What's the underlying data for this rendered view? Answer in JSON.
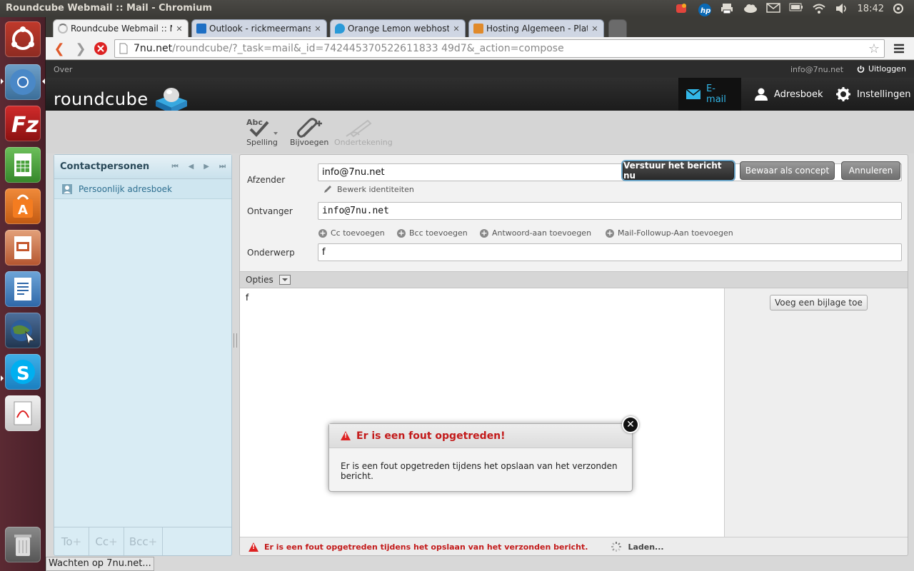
{
  "system": {
    "window_title": "Roundcube Webmail :: Mail - Chromium",
    "clock": "18:42"
  },
  "browser": {
    "tabs": [
      {
        "label": "Roundcube Webmail :: Ma",
        "favicon_color": "#888888",
        "active": true
      },
      {
        "label": "Outlook - rickmeermans@",
        "favicon_color": "#1e6fc4",
        "active": false
      },
      {
        "label": "Orange Lemon webhostin",
        "favicon_color": "#2a9ad8",
        "active": false
      },
      {
        "label": "Hosting Algemeen - Plat",
        "favicon_color": "#e08a2a",
        "active": false
      }
    ],
    "url_host": "7nu.net",
    "url_rest": "/roundcube/?_task=mail&_id=742445370522611833 49d7&_action=compose",
    "status_text": "Wachten op 7nu.net..."
  },
  "rc": {
    "about_link": "Over",
    "user_email": "info@7nu.net",
    "logout": "Uitloggen",
    "logo_text": "roundcube",
    "nav": {
      "email": "E-mail",
      "addressbook": "Adresboek",
      "settings": "Instellingen"
    },
    "toolbar": {
      "spell": "Spelling",
      "attach": "Bijvoegen",
      "signature": "Ondertekening",
      "spell_glyph": "Abc"
    },
    "left": {
      "title": "Contactpersonen",
      "addressbook": "Persoonlijk adresboek",
      "recipients": [
        "To",
        "Cc",
        "Bcc"
      ]
    },
    "compose": {
      "from_label": "Afzender",
      "from_value": "info@7nu.net",
      "edit_identities": "Bewerk identiteiten",
      "to_label": "Ontvanger",
      "to_value": "info@7nu.net",
      "add_cc": "Cc toevoegen",
      "add_bcc": "Bcc toevoegen",
      "add_replyto": "Antwoord-aan toevoegen",
      "add_followupto": "Mail-Followup-Aan toevoegen",
      "subject_label": "Onderwerp",
      "subject_value": "f",
      "send_button": "Verstuur het bericht nu",
      "save_button": "Bewaar als concept",
      "cancel_button": "Annuleren",
      "options_label": "Opties",
      "body": "f",
      "add_attachment": "Voeg een bijlage toe"
    },
    "error": {
      "title": "Er is een fout opgetreden!",
      "message": "Er is een fout opgetreden tijdens het opslaan van het verzonden bericht.",
      "status_message": "Er is een fout opgetreden tijdens het opslaan van het verzonden bericht.",
      "loading": "Laden..."
    }
  }
}
